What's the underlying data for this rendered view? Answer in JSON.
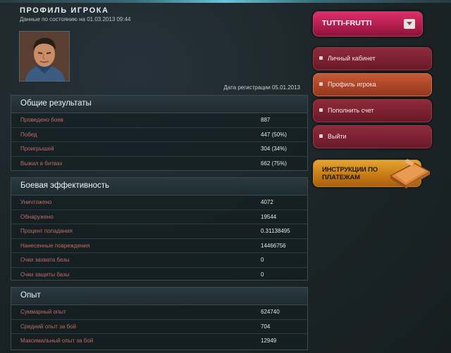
{
  "header": {
    "title": "ПРОФИЛЬ ИГРОКА",
    "data_date": "Данные по состоянию на 01.03.2013 09:44",
    "registration": "Дата регистрации 05.01.2013"
  },
  "user": {
    "name": "TUTTI-FRUTTI"
  },
  "menu": [
    {
      "label": "Личный кабинет",
      "active": false
    },
    {
      "label": "Профиль игрока",
      "active": true
    },
    {
      "label": "Пополнить счет",
      "active": false
    },
    {
      "label": "Выйти",
      "active": false
    }
  ],
  "instructions": {
    "line1": "ИНСТРУКЦИИ ПО",
    "line2": "ПЛАТЕЖАМ"
  },
  "sections": {
    "general": {
      "title": "Общие результаты",
      "rows": [
        {
          "label": "Проведено боев",
          "value": "887"
        },
        {
          "label": "Побед",
          "value": "447 (50%)"
        },
        {
          "label": "Проигрышей",
          "value": "304 (34%)"
        },
        {
          "label": "Выжил в битвах",
          "value": "662 (75%)"
        }
      ]
    },
    "combat": {
      "title": "Боевая эффективность",
      "rows": [
        {
          "label": "Уничтожено",
          "value": "4072"
        },
        {
          "label": "Обнаружено",
          "value": "19544"
        },
        {
          "label": "Процент попадания",
          "value": "0.31138495"
        },
        {
          "label": "Нанесенные повреждения",
          "value": "14466756"
        },
        {
          "label": "Очки захвата базы",
          "value": "0"
        },
        {
          "label": "Очки защиты базы",
          "value": "0"
        }
      ]
    },
    "experience": {
      "title": "Опыт",
      "rows": [
        {
          "label": "Суммарный опыт",
          "value": "624740"
        },
        {
          "label": "Средний опыт за бой",
          "value": "704"
        },
        {
          "label": "Максимальный опыт за бой",
          "value": "12949"
        }
      ]
    }
  },
  "colors": {
    "background": "#1b2426",
    "label": "#c06b63",
    "user_button": "#dd2f69",
    "menu_item": "#8e2b3a",
    "menu_active": "#c55a36",
    "instructions": "#e6a431"
  },
  "icons": {
    "avatar": "player-portrait",
    "book": "book-icon",
    "dropdown": "chevron-down-icon"
  }
}
